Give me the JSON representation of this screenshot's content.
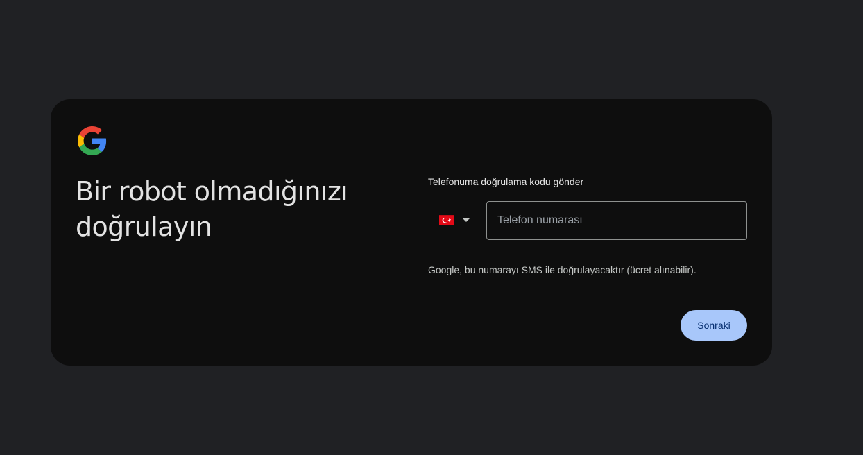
{
  "header": {
    "logo_icon": "google-g-icon",
    "title": "Bir robot olmadığınızı doğrulayın"
  },
  "verification": {
    "label": "Telefonuma doğrulama kodu gönder",
    "country": {
      "flag_icon": "turkey-flag-icon",
      "dropdown_icon": "caret-down-icon"
    },
    "phone_input": {
      "value": "",
      "placeholder": "Telefon numarası"
    },
    "helper_text": "Google, bu numarayı SMS ile doğrulayacaktır (ücret alınabilir).",
    "next_button": "Sonraki"
  },
  "colors": {
    "page_background": "#202124",
    "card_background": "#0e0e0e",
    "button_background": "#a8c7fa",
    "button_text": "#062e6f",
    "flag_red": "#e30a17"
  }
}
